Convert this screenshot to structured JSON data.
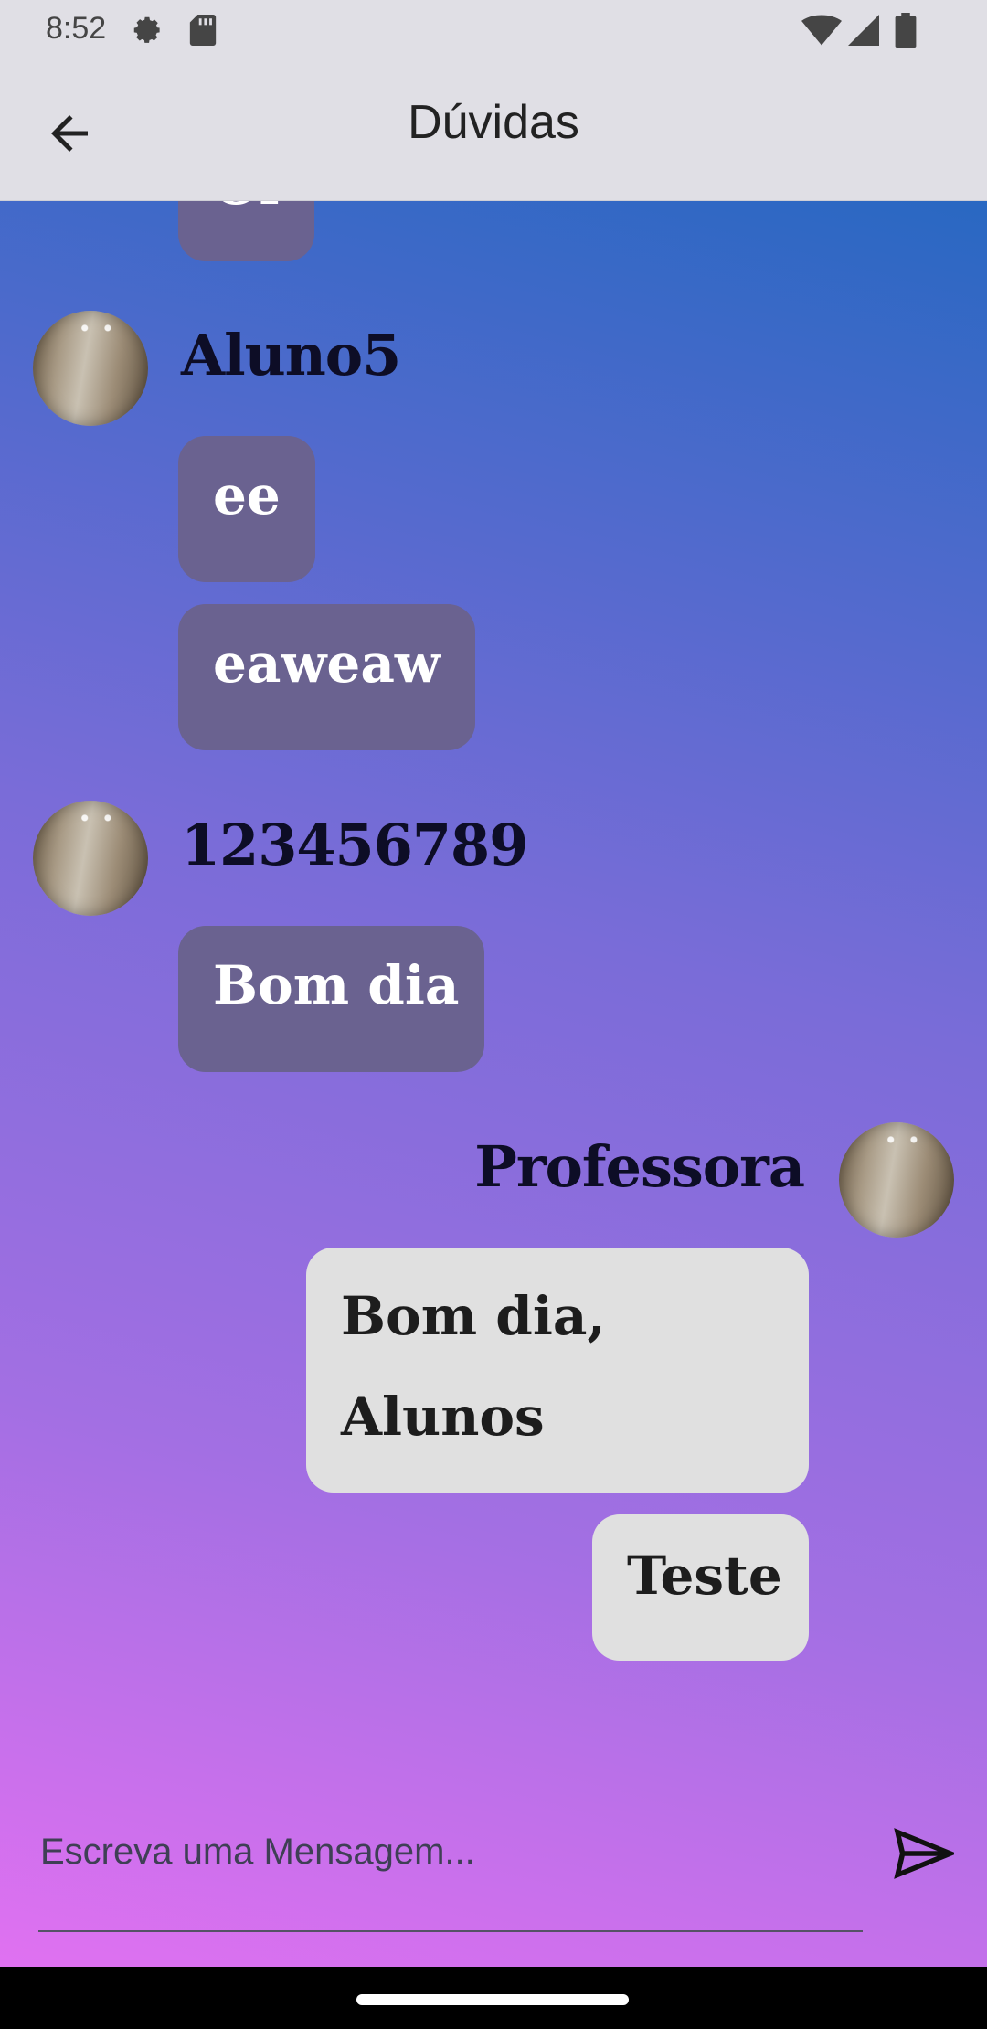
{
  "status_bar": {
    "time": "8:52"
  },
  "app_bar": {
    "title": "Dúvidas"
  },
  "messages": [
    {
      "sender": "",
      "text": "Ol",
      "type": "incoming"
    },
    {
      "sender": "Aluno5",
      "texts": [
        "ee",
        "eaweaw"
      ],
      "type": "incoming"
    },
    {
      "sender": "123456789",
      "texts": [
        "Bom dia"
      ],
      "type": "incoming"
    },
    {
      "sender": "Professora",
      "texts": [
        "Bom dia, Alunos",
        "Teste"
      ],
      "type": "outgoing"
    }
  ],
  "composer": {
    "placeholder": "Escreva uma Mensagem..."
  },
  "colors": {
    "incoming_bubble": "#6a6290",
    "outgoing_bubble": "#e0e0e0",
    "app_bar": "#e0dfe5",
    "gradient_top": "#2968c2",
    "gradient_bottom": "#e071f1"
  }
}
